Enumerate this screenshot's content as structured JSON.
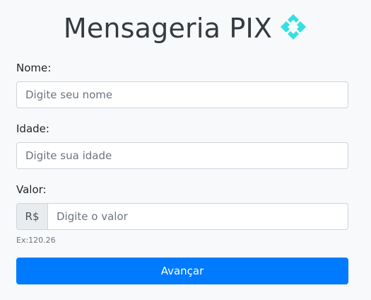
{
  "header": {
    "title": "Mensageria PIX",
    "logo_icon": "pix-logo-icon",
    "logo_color": "#32e0e6"
  },
  "form": {
    "name": {
      "label": "Nome:",
      "placeholder": "Digite seu nome",
      "value": ""
    },
    "age": {
      "label": "Idade:",
      "placeholder": "Digite sua idade",
      "value": ""
    },
    "amount": {
      "label": "Valor:",
      "prefix": "R$",
      "placeholder": "Digite o valor",
      "value": "",
      "hint": "Ex:120.26"
    },
    "submit_label": "Avançar"
  },
  "colors": {
    "primary": "#007bff",
    "background": "#f8f9fa",
    "title": "#343a40"
  }
}
